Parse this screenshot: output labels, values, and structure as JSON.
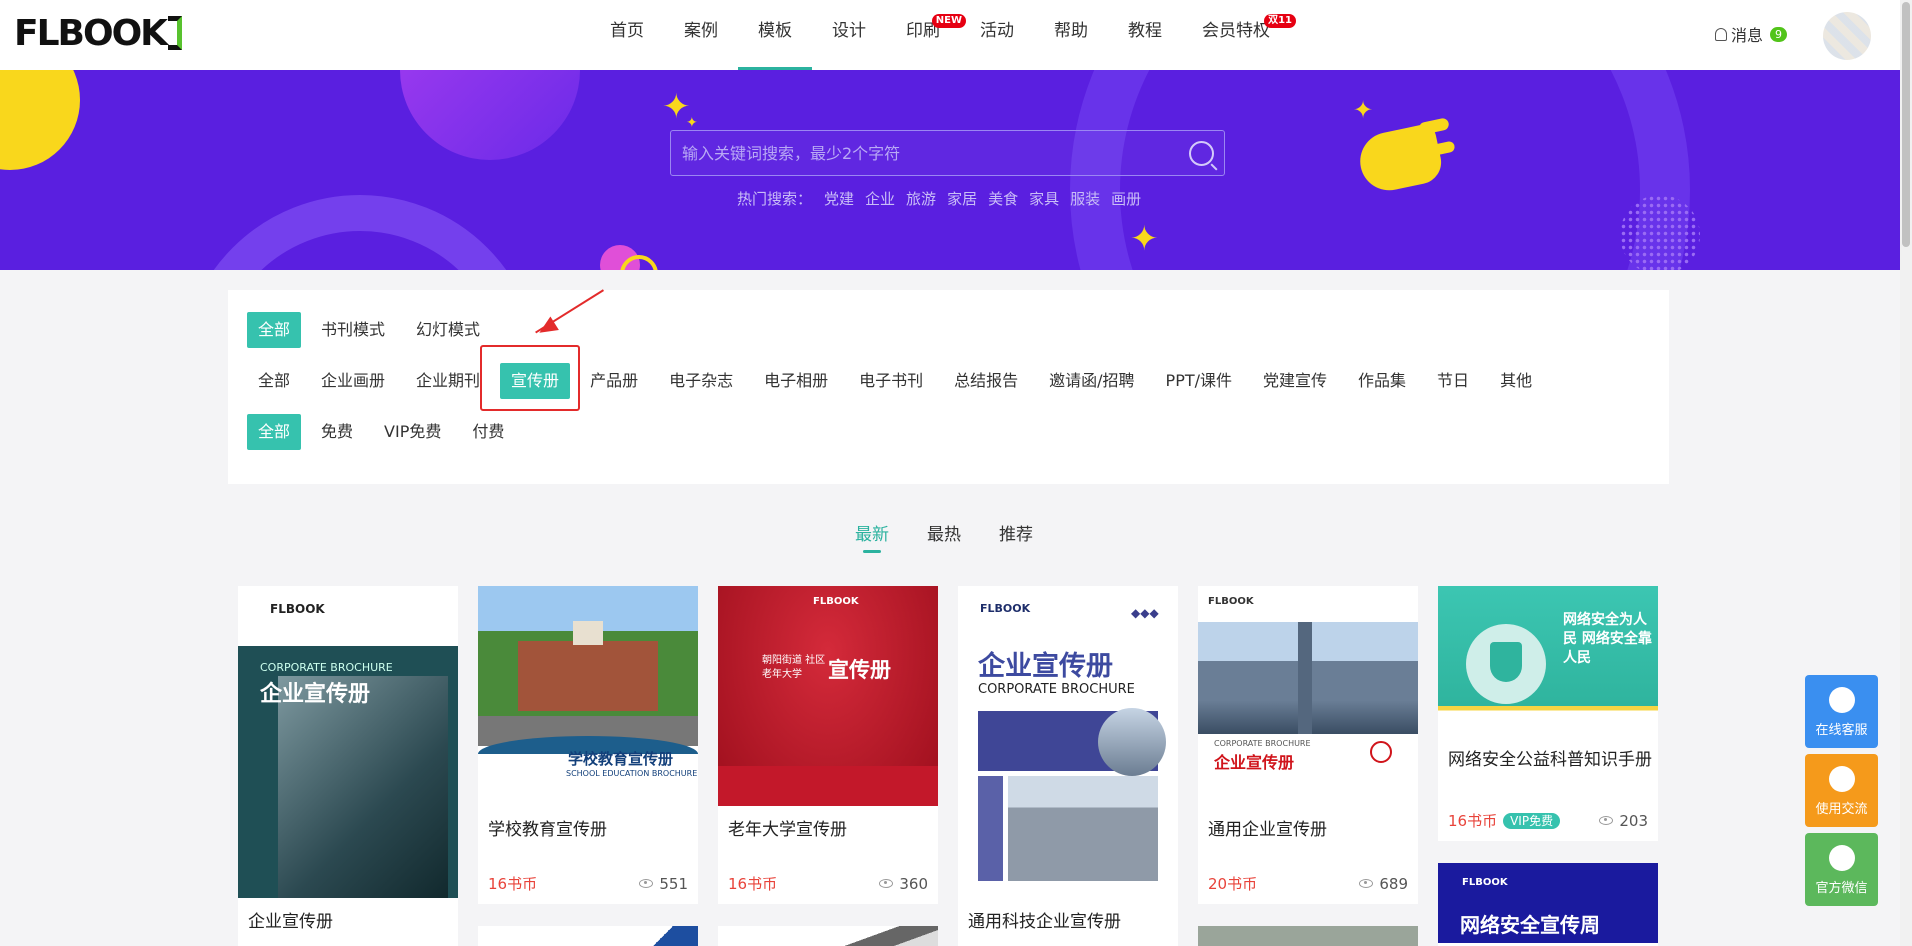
{
  "header": {
    "nav": [
      {
        "label": "首页",
        "active": false
      },
      {
        "label": "案例",
        "active": false
      },
      {
        "label": "模板",
        "active": true
      },
      {
        "label": "设计",
        "active": false
      },
      {
        "label": "印刷",
        "badge": "NEW",
        "active": false
      },
      {
        "label": "活动",
        "active": false
      },
      {
        "label": "帮助",
        "active": false
      },
      {
        "label": "教程",
        "active": false
      },
      {
        "label": "会员特权",
        "badge": "双11",
        "active": false
      }
    ],
    "message_label": "消息",
    "message_count": "9"
  },
  "banner": {
    "search_placeholder": "输入关键词搜索，最少2个字符",
    "hot_label": "热门搜索：",
    "hot_tags": [
      "党建",
      "企业",
      "旅游",
      "家居",
      "美食",
      "家具",
      "服装",
      "画册"
    ]
  },
  "filters": {
    "mode": [
      "全部",
      "书刊模式",
      "幻灯模式"
    ],
    "category": [
      "全部",
      "企业画册",
      "企业期刊",
      "宣传册",
      "产品册",
      "电子杂志",
      "电子相册",
      "电子书刊",
      "总结报告",
      "邀请函/招聘",
      "PPT/课件",
      "党建宣传",
      "作品集",
      "节日",
      "其他"
    ],
    "price": [
      "全部",
      "免费",
      "VIP免费",
      "付费"
    ]
  },
  "sort": [
    "最新",
    "最热",
    "推荐"
  ],
  "cards": [
    {
      "title": "企业宣传册"
    },
    {
      "title": "学校教育宣传册",
      "price": "16书币",
      "views": "551"
    },
    {
      "title": "老年大学宣传册",
      "price": "16书币",
      "views": "360"
    },
    {
      "title": "通用科技企业宣传册"
    },
    {
      "title": "通用企业宣传册",
      "price": "20书币",
      "views": "689"
    },
    {
      "title": "网络安全公益科普知识手册",
      "price": "16书币",
      "vip": "VIP免费",
      "views": "203"
    }
  ],
  "thumb_text": {
    "corp_en": "CORPORATE BROCHURE",
    "corp_zh": "企业宣传册",
    "school_zh": "学校教育宣传册",
    "school_en": "SCHOOL EDUCATION BROCHURE",
    "red_zh": "宣传册",
    "red_sub": "朝阳街道 社区老年大学",
    "tech_zh": "企业宣传册",
    "tech_en": "CORPORATE BROCHURE",
    "city_en": "CORPORATE BROCHURE",
    "city_zh": "企业宣传册",
    "sec_zh": "网络安全为人民 网络安全靠人民",
    "week_zh": "网络安全宣传周"
  },
  "side_float": [
    "在线客服",
    "使用交流",
    "官方微信"
  ],
  "colors": {
    "accent": "#36c2ae",
    "banner": "#5a1fe0",
    "price": "#e8433a",
    "annotation": "#e32b2b"
  }
}
